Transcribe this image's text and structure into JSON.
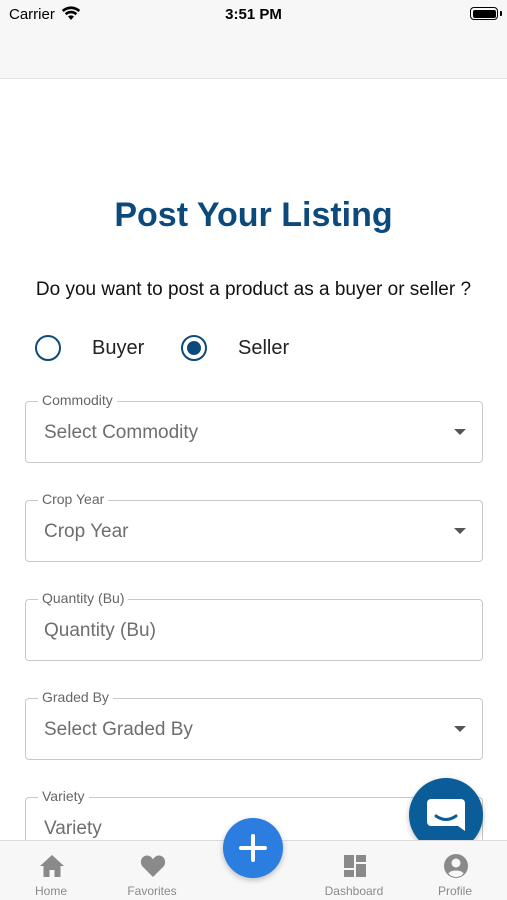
{
  "status_bar": {
    "carrier": "Carrier",
    "time": "3:51 PM"
  },
  "page": {
    "title": "Post Your Listing",
    "question": "Do you want to post a product as a buyer or seller ?"
  },
  "role": {
    "options": [
      {
        "label": "Buyer",
        "selected": false
      },
      {
        "label": "Seller",
        "selected": true
      }
    ]
  },
  "form": {
    "fields": [
      {
        "label": "Commodity",
        "value": "Select Commodity",
        "type": "dropdown"
      },
      {
        "label": "Crop Year",
        "value": "Crop Year",
        "type": "dropdown"
      },
      {
        "label": "Quantity (Bu)",
        "value": "Quantity (Bu)",
        "type": "text"
      },
      {
        "label": "Graded By",
        "value": "Select Graded By",
        "type": "dropdown"
      },
      {
        "label": "Variety",
        "value": "Variety",
        "type": "text"
      }
    ]
  },
  "tabs": [
    {
      "label": "Home",
      "icon": "home-icon"
    },
    {
      "label": "Favorites",
      "icon": "heart-icon"
    },
    {
      "label": "Dashboard",
      "icon": "dashboard-icon"
    },
    {
      "label": "Profile",
      "icon": "profile-icon"
    }
  ],
  "actions": {
    "add_icon": "plus-icon",
    "chat_icon": "chat-icon"
  },
  "colors": {
    "primary": "#0d4a7c",
    "fab": "#2c7de0",
    "chat": "#0b5d9a",
    "tab_inactive": "#8a8a8a"
  }
}
